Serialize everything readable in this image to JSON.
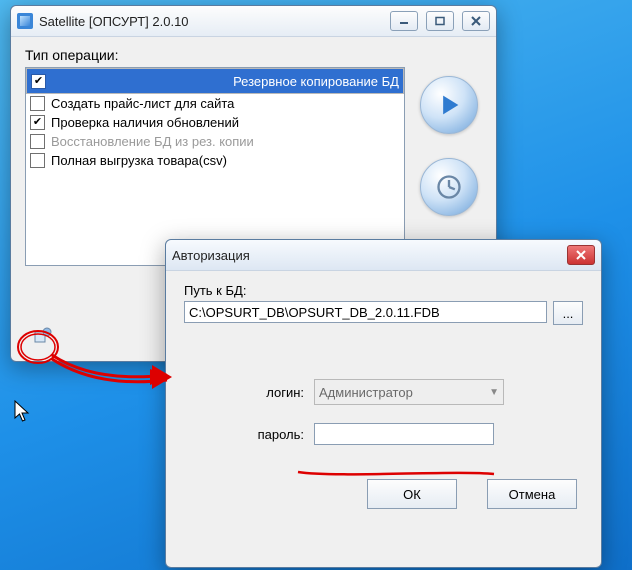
{
  "satellite": {
    "title": "Satellite [ОПСУРТ] 2.0.10",
    "group_label": "Тип операции:",
    "items": [
      {
        "label": "Резервное  копирование БД",
        "checked": true,
        "selected": true,
        "disabled": false
      },
      {
        "label": "Создать прайс-лист для сайта",
        "checked": false,
        "selected": false,
        "disabled": false
      },
      {
        "label": "Проверка наличия обновлений",
        "checked": true,
        "selected": false,
        "disabled": false
      },
      {
        "label": "Восстановление БД из рез. копии",
        "checked": false,
        "selected": false,
        "disabled": true
      },
      {
        "label": "Полная выгрузка товара(csv)",
        "checked": false,
        "selected": false,
        "disabled": false
      }
    ]
  },
  "auth": {
    "title": "Авторизация",
    "path_label": "Путь к БД:",
    "path_value": "C:\\OPSURT_DB\\OPSURT_DB_2.0.11.FDB",
    "browse_label": "...",
    "login_label": "логин:",
    "login_value": "Администратор",
    "password_label": "пароль:",
    "password_value": "",
    "ok_label": "ОК",
    "cancel_label": "Отмена"
  }
}
